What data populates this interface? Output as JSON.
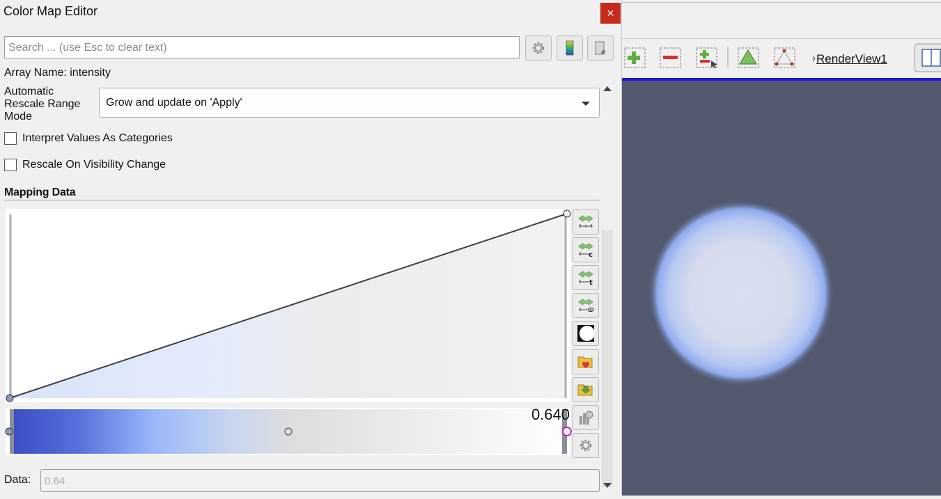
{
  "window": {
    "title": "Color Map Editor",
    "close_glyph": "×"
  },
  "search": {
    "placeholder": "Search ... (use Esc to clear text)",
    "value": ""
  },
  "toolbar": {
    "icons": [
      "gear-icon",
      "colormap-presets-icon",
      "edit-advanced-icon"
    ]
  },
  "array": {
    "label": "Array Name: intensity"
  },
  "rescale": {
    "label": "Automatic Rescale Range Mode",
    "selected": "Grow and update on 'Apply'"
  },
  "checkboxes": {
    "interpret_categories": {
      "label": "Interpret Values As Categories",
      "checked": false
    },
    "rescale_visibility": {
      "label": "Rescale On Visibility Change",
      "checked": false
    }
  },
  "mapping": {
    "section_title": "Mapping Data",
    "opacity_points": [
      {
        "x": 0.0,
        "y": 0.0
      },
      {
        "x": 1.0,
        "y": 1.0
      }
    ],
    "color_points": [
      {
        "x": 0.0,
        "color": "#3b4cc0"
      },
      {
        "x": 0.5,
        "color": "#dddddd"
      },
      {
        "x": 1.0,
        "color": "#ffffff"
      }
    ],
    "current_value": "0.640",
    "selected_point_color": "#d020d0",
    "side_buttons": [
      "rescale-to-data-icon",
      "rescale-to-custom-icon",
      "rescale-to-temporal-icon",
      "rescale-to-visible-icon",
      "invert-transfer-icon",
      "save-favorite-icon",
      "import-preset-icon",
      "data-histogram-icon",
      "settings-gear-icon"
    ]
  },
  "data_field": {
    "label": "Data:",
    "value": "0.64"
  },
  "render_view": {
    "label": "RenderView1",
    "prefix_glyph": "›",
    "background": "#52586e",
    "toolbar_icons": [
      "zoom-in-icon",
      "zoom-out-icon",
      "zoom-to-box-icon",
      "select-triangle-icon",
      "select-points-icon"
    ],
    "sphere_colors": [
      "#d9dfee",
      "#aec2f2",
      "#7e9ce8"
    ]
  }
}
